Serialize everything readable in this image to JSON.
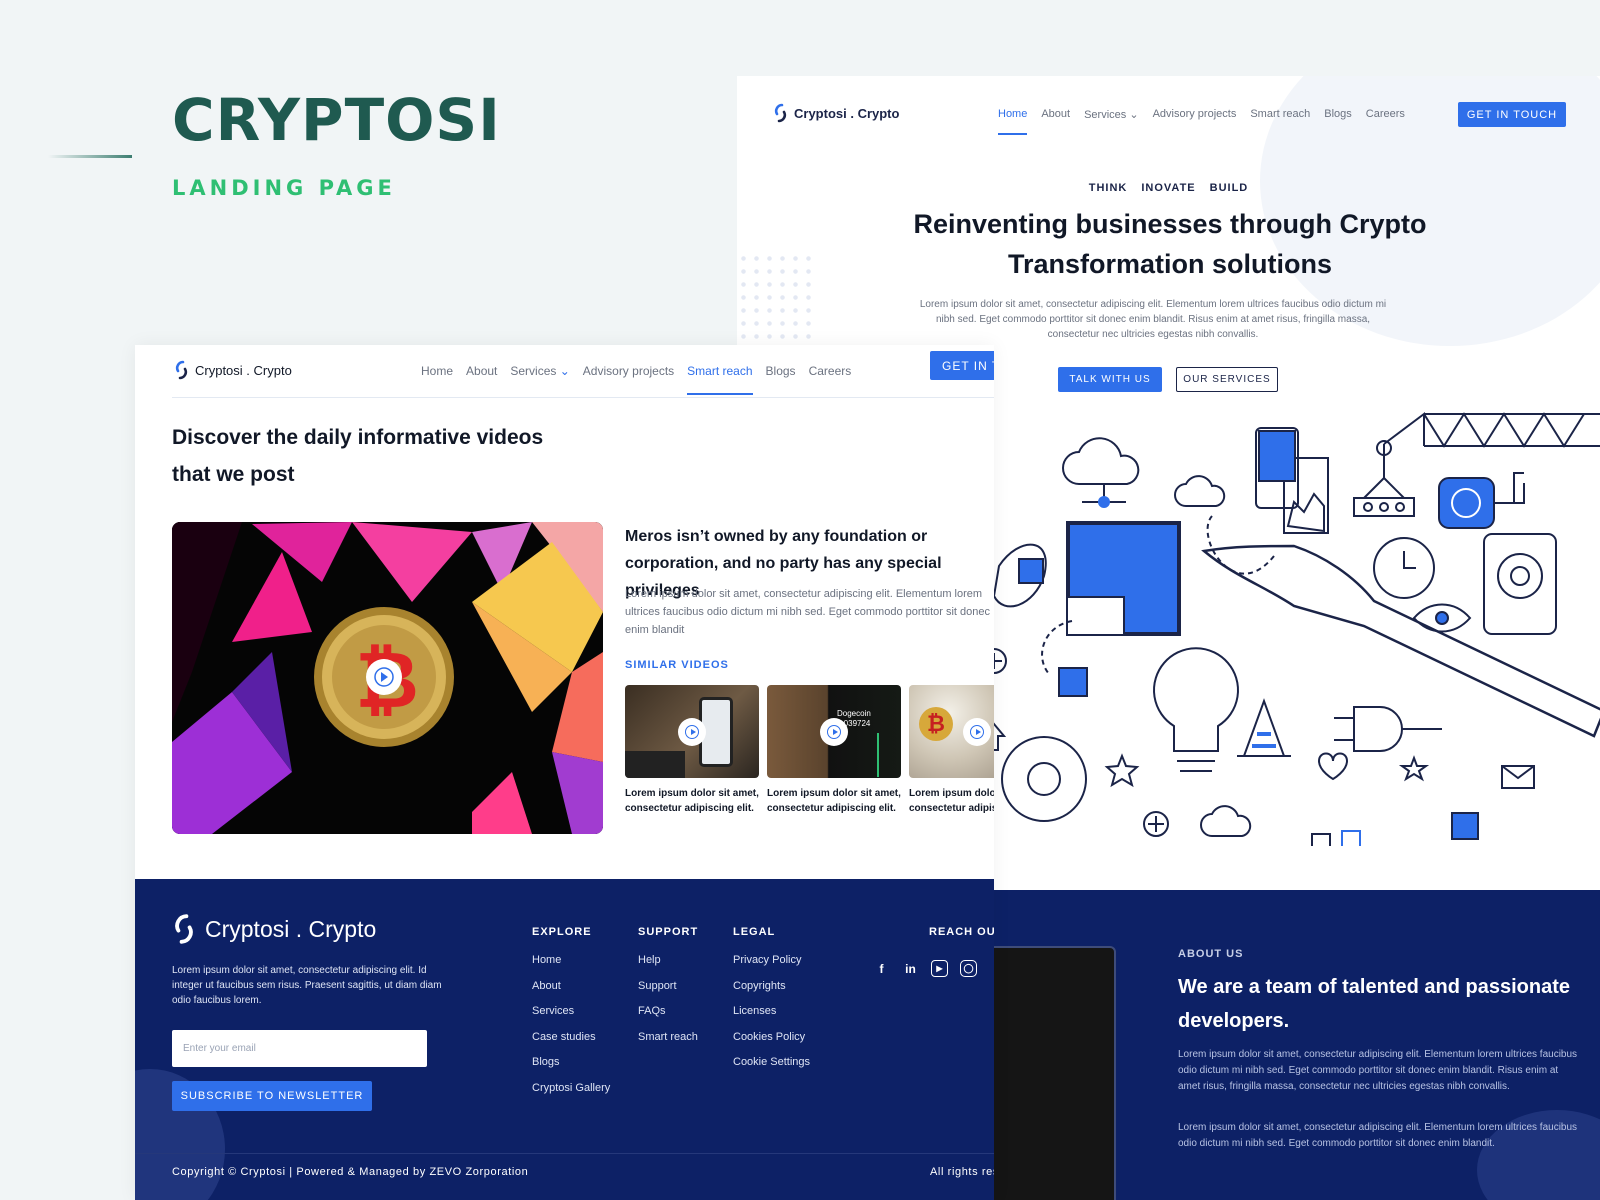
{
  "cover": {
    "title": "CRYPTOSI",
    "subtitle": "LANDING PAGE"
  },
  "hero_page": {
    "logo": "Cryptosi . Crypto",
    "nav": [
      "Home",
      "About",
      "Services",
      "Advisory projects",
      "Smart reach",
      "Blogs",
      "Careers"
    ],
    "active_nav": "Home",
    "cta": "GET IN TOUCH",
    "tagline": [
      "THINK",
      "INOVATE",
      "BUILD"
    ],
    "headline": "Reinventing businesses through Crypto Transformation solutions",
    "paragraph": "Lorem ipsum dolor sit amet, consectetur adipiscing elit. Elementum lorem ultrices faucibus odio dictum mi nibh sed. Eget commodo porttitor sit donec enim blandit. Risus enim at amet risus, fringilla massa, consectetur nec ultricies egestas nibh convallis.",
    "btn_primary": "TALK WITH US",
    "btn_secondary": "OUR SERVICES",
    "about": {
      "label": "ABOUT US",
      "heading": "We are a team of talented and passionate developers.",
      "p1": "Lorem ipsum dolor sit amet, consectetur adipiscing elit. Elementum lorem ultrices faucibus odio dictum mi nibh sed. Eget commodo porttitor sit donec enim blandit. Risus enim at amet risus, fringilla massa, consectetur nec ultricies egestas nibh convallis.",
      "p2": "Lorem ipsum dolor sit amet, consectetur adipiscing elit. Elementum lorem ultrices faucibus odio dictum mi nibh sed. Eget commodo porttitor sit donec enim blandit."
    }
  },
  "videos_page": {
    "logo": "Cryptosi . Crypto",
    "nav": [
      "Home",
      "About",
      "Services",
      "Advisory projects",
      "Smart reach",
      "Blogs",
      "Careers"
    ],
    "active_nav": "Smart reach",
    "cta": "GET IN TOUCH",
    "heading": "Discover the daily informative videos that we post",
    "feature_title": "Meros isn’t owned by any foundation or corporation, and no party has any special privileges",
    "feature_desc": "Lorem ipsum dolor sit amet, consectetur adipiscing elit. Elementum lorem ultrices faucibus odio dictum mi nibh sed. Eget commodo porttitor sit donec enim blandit",
    "similar_label": "SIMILAR VIDEOS",
    "thumbs": [
      {
        "caption": "Lorem ipsum dolor sit amet, consectetur adipiscing elit."
      },
      {
        "caption": "Lorem ipsum dolor sit amet, consectetur adipiscing elit.",
        "screen_text": "Dogecoin",
        "screen_value": "0.039724"
      },
      {
        "caption": "Lorem ipsum dolor sit amet, consectetur adipiscing elit."
      }
    ],
    "footer": {
      "logo": "Cryptosi . Crypto",
      "desc": "Lorem ipsum dolor sit amet, consectetur adipiscing elit. Id integer ut faucibus sem risus. Praesent sagittis, ut diam diam odio faucibus lorem.",
      "email_placeholder": "Enter your email",
      "subscribe": "SUBSCRIBE TO NEWSLETTER",
      "columns": [
        {
          "title": "EXPLORE",
          "items": [
            "Home",
            "About",
            "Services",
            "Case studies",
            "Blogs",
            "Cryptosi Gallery"
          ]
        },
        {
          "title": "SUPPORT",
          "items": [
            "Help",
            "Support",
            "FAQs",
            "Smart reach"
          ]
        },
        {
          "title": "LEGAL",
          "items": [
            "Privacy Policy",
            "Copyrights",
            "Licenses",
            "Cookies Policy",
            "Cookie Settings"
          ]
        }
      ],
      "reach_title": "REACH OUT",
      "socials": [
        "facebook-icon",
        "linkedin-icon",
        "youtube-icon",
        "instagram-icon"
      ],
      "copyright": "Copyright © Cryptosi | Powered & Managed by ZEVO Zorporation",
      "rights": "All rights reserved"
    }
  },
  "colors": {
    "accent": "#2f6fea",
    "navy": "#0d2166",
    "brand_green": "#1f5a50",
    "sub_green": "#2fbf73"
  }
}
